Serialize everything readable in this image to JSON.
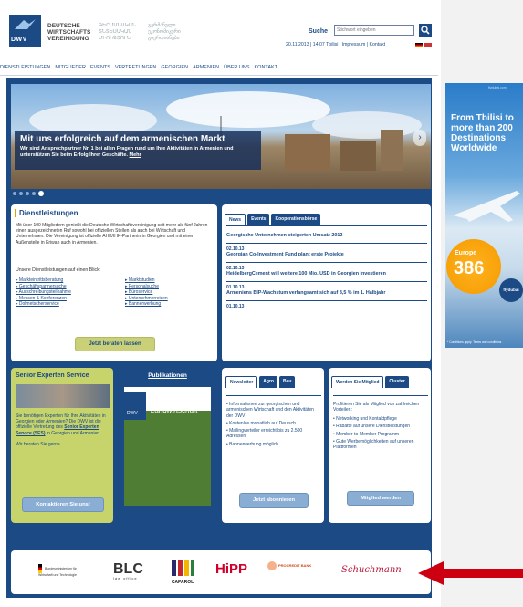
{
  "header": {
    "logo_text": "DWV",
    "org_name_lines": [
      "DEUTSCHE",
      "WIRTSCHAFTS",
      "VEREINIGUNG"
    ],
    "org_name_am": [
      "ԳԵՐՄԱՆԱԿԱՆ",
      "ՏՆՏԵՍԱԿԱՆ",
      "ՄԻՈՒԹՅՈՒՆ"
    ],
    "org_name_ge": [
      "გერმანული",
      "ეკონომიკური",
      "გაერთიანება"
    ],
    "search_label": "Suche",
    "search_placeholder": "Stichwort eingeben",
    "date_line": "20.11.2013 | 14:07 Tbilisi | Impressum | Kontakt"
  },
  "nav": [
    "DIENSTLEISTUNGEN",
    "MITGLIEDER",
    "EVENTS",
    "VERTRETUNGEN",
    "GEORGIEN",
    "ARMENIEN",
    "ÜBER UNS",
    "KONTAKT"
  ],
  "hero": {
    "title": "Mit uns erfolgreich auf dem armenischen Markt",
    "text": "Wir sind Ansprechpartner Nr. 1 bei allen Fragen rund um Ihre Aktivitäten in Armenien und unterstützen Sie beim Erfolg Ihrer Geschäfte.",
    "more_link": "Mehr"
  },
  "dienst": {
    "title": "Dienstleistungen",
    "intro": "Mit über 100 Mitgliedern genießt die Deutsche Wirtschaftsvereinigung seit mehr als fünf Jahren einen ausgezeichneten Ruf sowohl bei offiziellen Stellen als auch bei Wirtschaft und Unternehmen. Die Vereinigung ist offizielle AHK/IHK-Partnerin in Georgien und mit einer Außenstelle in Eriwan auch in Armenien.",
    "subtitle": "Unsere Dienstleistungen auf einen Blick:",
    "list_left": [
      "Markteintrittsberatung",
      "Geschäftspartnersuche",
      "Ausschreibungsteilnahme",
      "Messen & Konferenzen",
      "Dolmetscherservice"
    ],
    "list_right": [
      "Marktstudien",
      "Personalsuche",
      "Büroservice",
      "Unternehmerreisen",
      "Bannerwerbung"
    ],
    "button": "Jetzt beraten lassen"
  },
  "news": {
    "tabs": [
      "News",
      "Events",
      "Kooperationsbörse"
    ],
    "items": [
      {
        "date": "",
        "headline": "Georgische Unternehmen steigerten Umsatz 2012"
      },
      {
        "date": "02.10.13",
        "headline": "Georgian Co-Investment Fund plant erste Projekte"
      },
      {
        "date": "02.10.13",
        "headline": "HeidelbergCement will weitere 100 Mio. USD in Georgien investieren"
      },
      {
        "date": "01.10.13",
        "headline": "Armeniens BIP-Wachstum verlangsamt sich auf 3,5 % im 1. Halbjahr"
      },
      {
        "date": "01.10.13",
        "headline": ""
      }
    ]
  },
  "senior": {
    "title": "Senior Experten Service",
    "text_a": "Sie benötigen Experten für Ihre Aktivitäten in Georgien oder Armenien? Die DWV ist die offizielle Vertretung des",
    "text_link": "Senior Experten Service (SES)",
    "text_b": "in Georgien und Armenien.",
    "text_c": "Wir beraten Sie gerne.",
    "button": "Kontaktieren Sie uns!"
  },
  "publ": {
    "title": "Publikationen",
    "book_title": "Landwirtschaft",
    "book_logo": "DWV"
  },
  "newsletter": {
    "tabs": [
      "Newsletter",
      "Agro",
      "Bau"
    ],
    "items": [
      "Informationen zur georgischen und armenischen Wirtschaft und den Aktivitäten der DWV",
      "Kostenlos monatlich auf Deutsch",
      "Mailingverteiler erreicht bis zu 2.500 Adressen",
      "Bannerwerbung möglich"
    ],
    "button": "Jetzt abonnieren"
  },
  "member": {
    "tabs": [
      "Werden Sie Mitglied",
      "Cluster"
    ],
    "intro": "Profitieren Sie als Mitglied von zahlreichen Vorteilen:",
    "items": [
      "Networking und Kontaktpflege",
      "Rabatte auf unsere Dienstleistungen",
      "Member-to-Member Programm",
      "Gute Werbemöglichkeiten auf unseren Plattformen"
    ],
    "button": "Mitglied werden"
  },
  "partners": {
    "logos": [
      "Bundesministerium für Wirtschaft und Technologie",
      "BLC",
      "CAPAROL",
      "HiPP",
      "Schuchmann"
    ],
    "blc_sub": "law office",
    "procredit": "PROCREDIT BANK"
  },
  "ad": {
    "top": "flydubai.com",
    "headline": "From Tbilisi to more than 200 Destinations Worldwide",
    "region": "Europe",
    "price": "386",
    "stamp": "flydubai",
    "footer": "* Conditions apply. Terms and conditions"
  },
  "colors": {
    "brand": "#1b4a85",
    "accent": "#c9d078",
    "arrow": "#cc0011"
  }
}
